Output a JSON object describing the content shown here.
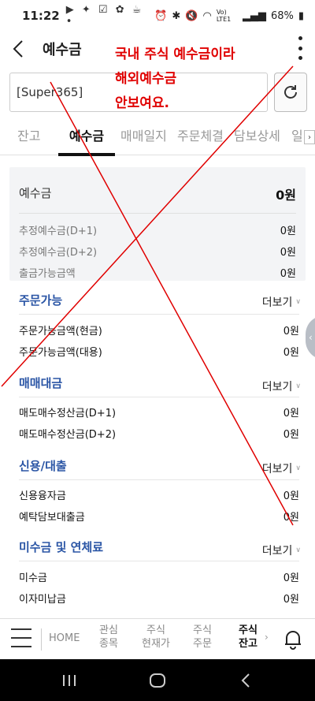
{
  "status_bar": {
    "time": "11:22",
    "network": "Vo) LTE1",
    "battery": "68%"
  },
  "header": {
    "title": "예수금"
  },
  "account": {
    "value": "[Super365]"
  },
  "tabs": [
    "잔고",
    "예수금",
    "매매일지",
    "주문체결",
    "담보상세",
    "일"
  ],
  "active_tab": "예수금",
  "summary": {
    "main_label": "예수금",
    "main_value": "0원",
    "rows": [
      {
        "label": "추정예수금(D+1)",
        "value": "0원"
      },
      {
        "label": "추정예수금(D+2)",
        "value": "0원"
      },
      {
        "label": "출금가능금액",
        "value": "0원"
      }
    ]
  },
  "sections": [
    {
      "title": "주문가능",
      "more": "더보기",
      "rows": [
        {
          "label": "주문가능금액(현금)",
          "value": "0원"
        },
        {
          "label": "주문가능금액(대용)",
          "value": "0원"
        }
      ]
    },
    {
      "title": "매매대금",
      "more": "더보기",
      "rows": [
        {
          "label": "매도매수정산금(D+1)",
          "value": "0원"
        },
        {
          "label": "매도매수정산금(D+2)",
          "value": "0원"
        }
      ]
    },
    {
      "title": "신용/대출",
      "more": "더보기",
      "rows": [
        {
          "label": "신용융자금",
          "value": "0원"
        },
        {
          "label": "예탁담보대출금",
          "value": "0원"
        }
      ]
    },
    {
      "title": "미수금 및 연체료",
      "more": "더보기",
      "rows": [
        {
          "label": "미수금",
          "value": "0원"
        },
        {
          "label": "이자미납금",
          "value": "0원"
        }
      ]
    }
  ],
  "bottom_nav": {
    "items": [
      {
        "label": "HOME"
      },
      {
        "label": "관심\n종목"
      },
      {
        "label": "주식\n현재가"
      },
      {
        "label": "주식\n주문"
      },
      {
        "label": "주식\n잔고"
      }
    ],
    "active": "주식\n잔고"
  },
  "annotation": {
    "text": "국내 주식 예수금이라\n해외예수금\n안보여요.",
    "color": "#e00000"
  },
  "colors": {
    "accent": "#2a55a5",
    "annotation_red": "#e00000",
    "summary_bg": "#f3f4f6"
  },
  "icons": {
    "back": "chevron-left-icon",
    "more": "more-vertical-icon",
    "refresh": "refresh-icon",
    "menu": "hamburger-menu-icon",
    "bell": "bell-icon"
  }
}
